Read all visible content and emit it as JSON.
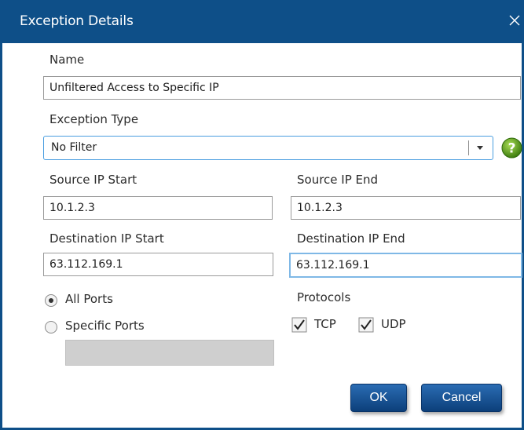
{
  "dialog": {
    "title": "Exception Details",
    "close_icon": "close-icon"
  },
  "name": {
    "label": "Name",
    "value": "Unfiltered Access to Specific IP"
  },
  "exception_type": {
    "label": "Exception Type",
    "selected": "No Filter",
    "help_icon": "help-question-icon",
    "accent_color": "#5a9e1a"
  },
  "source": {
    "start_label": "Source IP Start",
    "start_value": "10.1.2.3",
    "end_label": "Source IP End",
    "end_value": "10.1.2.3"
  },
  "destination": {
    "start_label": "Destination IP Start",
    "start_value": "63.112.169.1",
    "end_label": "Destination IP End",
    "end_value": "63.112.169.1"
  },
  "ports": {
    "all_label": "All Ports",
    "all_selected": true,
    "specific_label": "Specific Ports",
    "specific_selected": false,
    "specific_value": ""
  },
  "protocols": {
    "label": "Protocols",
    "tcp_label": "TCP",
    "tcp_checked": true,
    "udp_label": "UDP",
    "udp_checked": true
  },
  "buttons": {
    "ok_label": "OK",
    "cancel_label": "Cancel"
  },
  "colors": {
    "title_bar": "#0e4f88",
    "button": "#1c5597",
    "focus_border": "#7fb8e6"
  }
}
